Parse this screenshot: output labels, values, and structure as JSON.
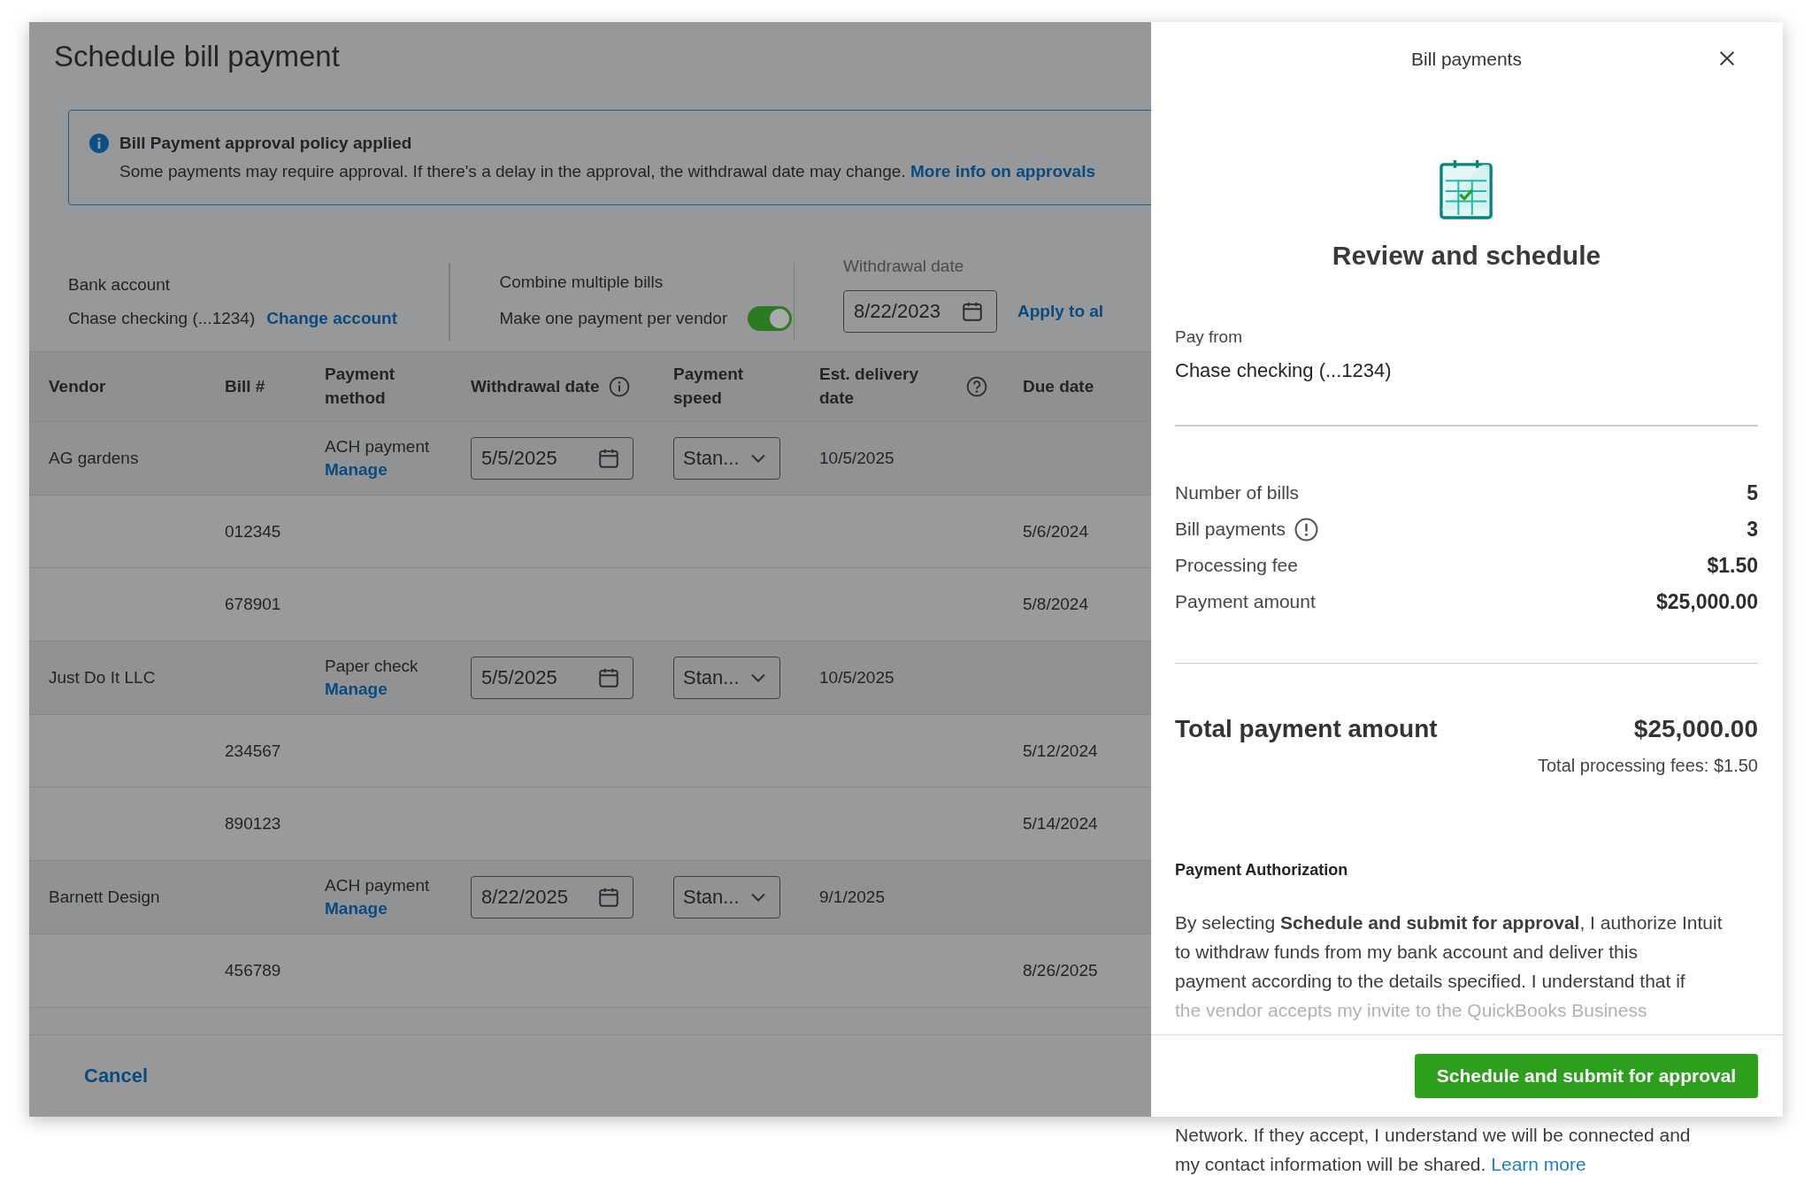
{
  "page": {
    "title": "Schedule bill payment",
    "banner": {
      "title": "Bill Payment approval policy applied",
      "text": "Some payments may require approval. If there's a delay in the approval, the withdrawal date may change.",
      "link": "More info on approvals"
    },
    "bank_account": {
      "label": "Bank account",
      "value": "Chase checking (...1234)",
      "link": "Change account"
    },
    "combine": {
      "label": "Combine multiple bills",
      "text": "Make one payment per vendor",
      "on": true
    },
    "withdrawal": {
      "label": "Withdrawal date",
      "value": "8/22/2023",
      "link": "Apply to al"
    },
    "table": {
      "columns": [
        {
          "label": "Vendor",
          "kind": "text"
        },
        {
          "label": "Bill #",
          "kind": "text"
        },
        {
          "label": "Payment method",
          "kind": "text"
        },
        {
          "label": "Withdrawal date",
          "kind": "info"
        },
        {
          "label": "Payment speed",
          "kind": "text"
        },
        {
          "label": "Est. delivery date",
          "kind": "help"
        },
        {
          "label": "Due date",
          "kind": "text"
        }
      ],
      "rows": [
        {
          "kind": "vendor",
          "vendor": "AG gardens",
          "method": "ACH payment",
          "manage": "Manage",
          "withdrawal": "5/5/2025",
          "speed": "Stan...",
          "delivery": "10/5/2025"
        },
        {
          "kind": "bill",
          "bill": "012345",
          "due": "5/6/2024"
        },
        {
          "kind": "bill",
          "bill": "678901",
          "due": "5/8/2024"
        },
        {
          "kind": "vendor",
          "vendor": "Just Do It LLC",
          "method": "Paper check",
          "manage": "Manage",
          "withdrawal": "5/5/2025",
          "speed": "Stan...",
          "delivery": "10/5/2025"
        },
        {
          "kind": "bill",
          "bill": "234567",
          "due": "5/12/2024"
        },
        {
          "kind": "bill",
          "bill": "890123",
          "due": "5/14/2024"
        },
        {
          "kind": "vendor",
          "vendor": "Barnett Design",
          "method": "ACH payment",
          "manage": "Manage",
          "withdrawal": "8/22/2025",
          "speed": "Stan...",
          "delivery": "9/1/2025"
        },
        {
          "kind": "bill",
          "bill": "456789",
          "due": "8/26/2025"
        }
      ]
    },
    "cancel": "Cancel"
  },
  "drawer": {
    "title": "Bill payments",
    "heading": "Review and schedule",
    "pay_from": {
      "label": "Pay from",
      "value": "Chase checking (...1234)"
    },
    "summary": [
      {
        "label": "Number of bills",
        "value": "5",
        "kind": "plain"
      },
      {
        "label": "Bill payments",
        "value": "3",
        "kind": "alert"
      },
      {
        "label": "Processing fee",
        "value": "$1.50",
        "kind": "plain"
      },
      {
        "label": "Payment amount",
        "value": "$25,000.00",
        "kind": "plain"
      }
    ],
    "total": {
      "label": "Total payment amount",
      "value": "$25,000.00",
      "fees": "Total processing fees: $1.50"
    },
    "authorization": {
      "title": "Payment Authorization",
      "lines": [
        {
          "text": "By selecting **Schedule and submit for approval**, I authorize Intuit",
          "faded": false
        },
        {
          "text": "to withdraw funds from my bank account and deliver this",
          "faded": false
        },
        {
          "text": "payment according to the details specified. I understand that if",
          "faded": false
        },
        {
          "text": "the vendor accepts my invite to the QuickBooks Business",
          "faded": true
        }
      ]
    },
    "submit": "Schedule and submit for approval"
  },
  "overflow": {
    "lines": [
      "Network. If they accept, I understand we will be connected and",
      "my contact information will be shared."
    ],
    "link": "Learn more"
  }
}
